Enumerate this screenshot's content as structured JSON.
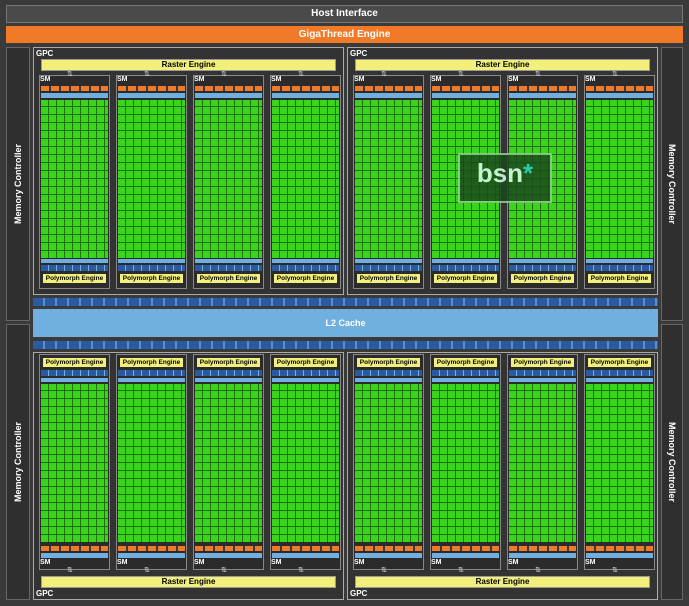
{
  "header": {
    "host_interface": "Host Interface",
    "gigathread": "GigaThread Engine"
  },
  "memory_controller": "Memory Controller",
  "gpc_label": "GPC",
  "raster_engine": "Raster Engine",
  "sm_label": "SM",
  "polymorph_engine": "Polymorph Engine",
  "l2_cache": "L2 Cache",
  "watermark": {
    "text": "bsn",
    "mark": "*"
  },
  "colors": {
    "core": "#35c21a",
    "raster": "#f2f07a",
    "gigathread": "#f07a28",
    "cache": "#6fb0e0"
  }
}
